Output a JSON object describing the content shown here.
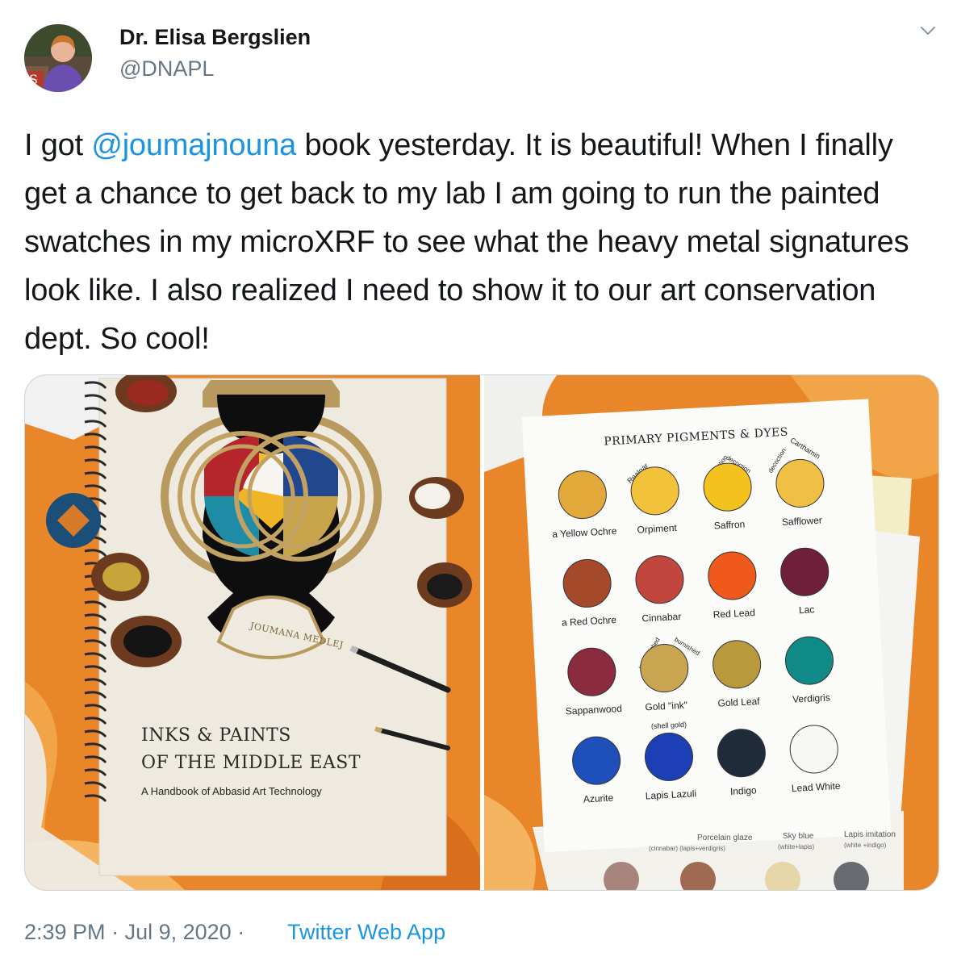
{
  "author": {
    "display_name": "Dr. Elisa Bergslien",
    "handle": "@DNAPL"
  },
  "tweet": {
    "text_before_mention": "I got ",
    "mention": "@joumajnouna",
    "text_after_mention": " book yesterday. It is beautiful! When I finally get a chance to get back to my lab I am going to run the painted swatches in my microXRF to see what the heavy metal signatures look like. I also realized I need to show it to our art conservation dept. So cool!"
  },
  "photos": {
    "left": {
      "book_author": "JOUMANA MEDLEJ",
      "book_title_line1": "INKS & PAINTS",
      "book_title_line2": "OF THE MIDDLE EAST",
      "book_subtitle": "A Handbook of Abbasid Art Technology"
    },
    "right": {
      "sheet_title": "PRIMARY PIGMENTS & DYES",
      "swatches": [
        {
          "label": "a Yellow Ochre",
          "color": "#e0a93a"
        },
        {
          "label": "Orpiment",
          "color": "#f2c23b"
        },
        {
          "label": "Saffron",
          "color": "#f4c21f"
        },
        {
          "label": "Safflower",
          "color": "#efc044"
        },
        {
          "label": "a Red Ochre",
          "color": "#a44a2a"
        },
        {
          "label": "Cinnabar",
          "color": "#c0463e"
        },
        {
          "label": "Red Lead",
          "color": "#f0591c"
        },
        {
          "label": "Lac",
          "color": "#6e1f3a"
        },
        {
          "label": "Sappanwood",
          "color": "#8b2b3e"
        },
        {
          "label": "Gold \"ink\"",
          "color": "#c9a552"
        },
        {
          "label": "Gold Leaf",
          "color": "#b89a3d"
        },
        {
          "label": "Verdigris",
          "color": "#0f8a86"
        },
        {
          "label": "Azurite",
          "color": "#1f4fb8"
        },
        {
          "label": "Lapis Lazuli",
          "color": "#1c3fb5"
        },
        {
          "label": "Indigo",
          "color": "#1f2a3b"
        },
        {
          "label": "Lead White",
          "color": "#f7f7f5"
        }
      ],
      "gold_ink_note": "(shell gold)",
      "annotations": {
        "realgar": "Realgar",
        "maceration": "maceration",
        "decoction1": "decoction",
        "decoction2": "decoction",
        "carthamin": "Carthamin",
        "unburnished": "unburnished",
        "burnished": "burnished"
      },
      "lower_sheet": {
        "porcelain": "Porcelain glaze",
        "porcelain_note": "(cinnabar) (lapis+verdigris)",
        "sky_blue": "Sky blue",
        "sky_blue_note": "(white+lapis)",
        "lapis_imitation": "Lapis imitation",
        "lapis_imitation_note": "(white +indigo)"
      }
    }
  },
  "footer": {
    "time": "2:39 PM",
    "date": "Jul 9, 2020",
    "separator": "·",
    "source": "Twitter Web App"
  },
  "colors": {
    "text": "#14171a",
    "secondary": "#657786",
    "link": "#1b95e0"
  }
}
